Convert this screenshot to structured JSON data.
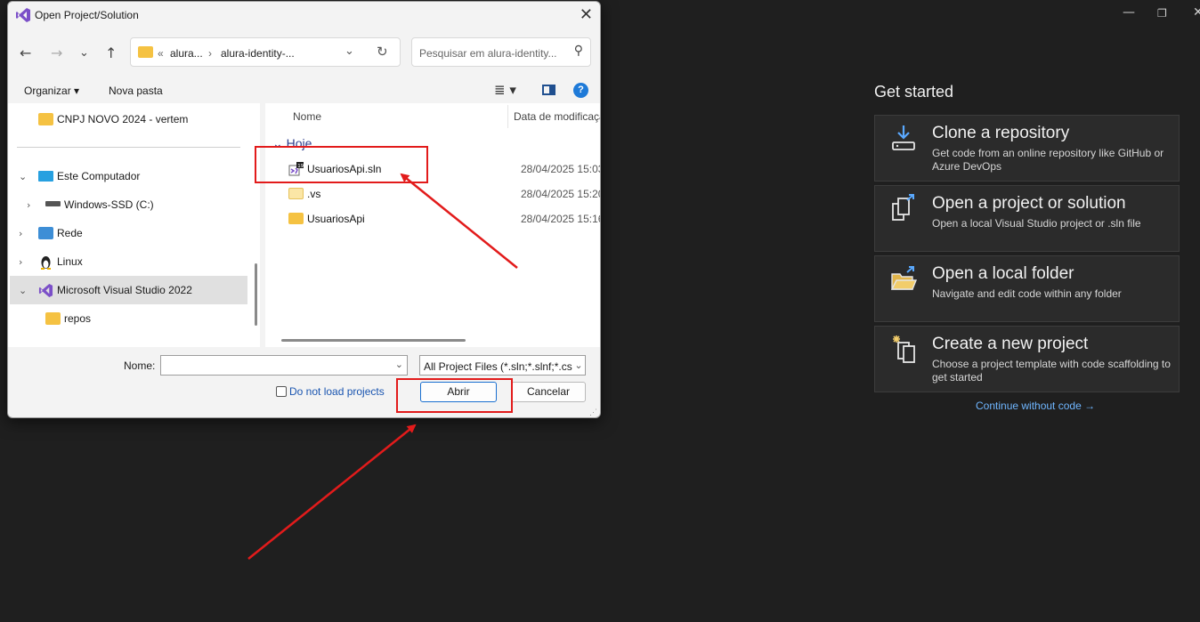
{
  "start_window": {
    "title_controls": {
      "minimize": "—",
      "restore": "❐",
      "close": "✕"
    },
    "heading": "Get started",
    "cards": [
      {
        "icon": "clone-repository-icon",
        "title": "Clone a repository",
        "description": "Get code from an online repository like GitHub or Azure DevOps"
      },
      {
        "icon": "open-project-icon",
        "title": "Open a project or solution",
        "description": "Open a local Visual Studio project or .sln file"
      },
      {
        "icon": "open-folder-icon",
        "title": "Open a local folder",
        "description": "Navigate and edit code within any folder"
      },
      {
        "icon": "new-project-icon",
        "title": "Create a new project",
        "description": "Choose a project template with code scaffolding to get started"
      }
    ],
    "continue_link": "Continue without code →"
  },
  "dialog": {
    "title": "Open Project/Solution",
    "nav": {
      "back": "←",
      "forward": "→",
      "recent": "⌄",
      "up": "↑"
    },
    "address": {
      "prefix": "«",
      "crumbs": [
        "alura...",
        "alura-identity-..."
      ],
      "separator": "›"
    },
    "search_placeholder": "Pesquisar em alura-identity...",
    "toolbar": {
      "organize": "Organizar ▾",
      "new_folder": "Nova pasta",
      "help": "?"
    },
    "tree": [
      {
        "label": "CNPJ NOVO 2024 - vertem",
        "icon": "folder-icon"
      },
      {
        "label": "Este Computador",
        "icon": "computer-icon",
        "chevron": "⌄"
      },
      {
        "label": "Windows-SSD (C:)",
        "icon": "drive-icon",
        "chevron": "›"
      },
      {
        "label": "Rede",
        "icon": "network-icon",
        "chevron": "›"
      },
      {
        "label": "Linux",
        "icon": "linux-icon",
        "chevron": "›"
      },
      {
        "label": "Microsoft Visual Studio 2022",
        "icon": "vs-icon",
        "chevron": "⌄",
        "selected": true
      },
      {
        "label": "repos",
        "icon": "folder-icon"
      }
    ],
    "columns": {
      "name": "Nome",
      "date": "Data de modificação"
    },
    "group": "⌄ Hoje",
    "files": [
      {
        "name": "UsuariosApi.sln",
        "date": "28/04/2025 15:03",
        "icon": "solution-file-icon"
      },
      {
        "name": ".vs",
        "date": "28/04/2025 15:20",
        "icon": "folder-icon"
      },
      {
        "name": "UsuariosApi",
        "date": "28/04/2025 15:16",
        "icon": "folder-icon"
      }
    ],
    "filename_label": "Nome:",
    "filename_value": "",
    "filetype": "All Project Files (*.sln;*.slnf;*.csproj)",
    "do_not_load": "Do not load projects",
    "open_button": "Abrir",
    "cancel_button": "Cancelar"
  },
  "colors": {
    "annotation": "#e21b1b",
    "link": "#6fb6ff",
    "accent": "#1e7ad8"
  }
}
